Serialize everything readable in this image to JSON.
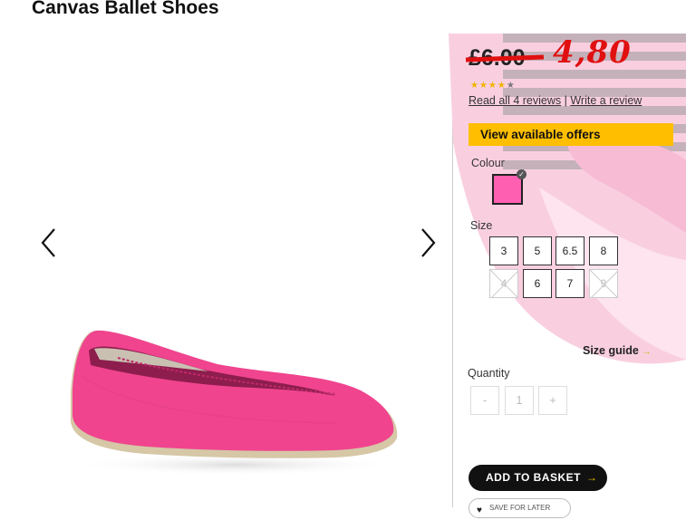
{
  "product": {
    "title": "Canvas Ballet Shoes",
    "price_old": "£6.00",
    "price_new": "4,80",
    "rating": 4.5,
    "stars": "★★★★",
    "star_half": "★"
  },
  "reviews": {
    "read_all": "Read all 4 reviews",
    "separator": "|",
    "write": "Write a review"
  },
  "offers_label": "View available offers",
  "colour": {
    "label": "Colour",
    "selected_swatch": "#ff5fb0",
    "check": "✓"
  },
  "size": {
    "label": "Size",
    "options": [
      {
        "value": "3",
        "available": true
      },
      {
        "value": "5",
        "available": true
      },
      {
        "value": "6.5",
        "available": true
      },
      {
        "value": "8",
        "available": true
      },
      {
        "value": "4",
        "available": false
      },
      {
        "value": "6",
        "available": true
      },
      {
        "value": "7",
        "available": true
      },
      {
        "value": "9",
        "available": false
      }
    ],
    "guide_label": "Size guide",
    "guide_arrow": "→"
  },
  "quantity": {
    "label": "Quantity",
    "minus": "-",
    "value": "1",
    "plus": "+"
  },
  "basket": {
    "label": "ADD TO BASKET",
    "arrow": "→"
  },
  "save_label": "SAVE FOR LATER",
  "colors": {
    "accent_yellow": "#ffbf00",
    "price_red": "#e01010",
    "shoe_pink": "#f0448f"
  }
}
